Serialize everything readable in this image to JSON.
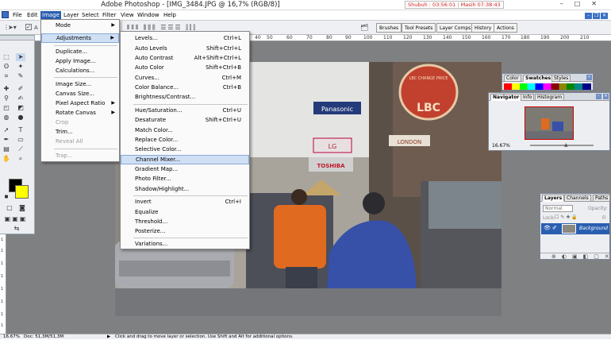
{
  "window": {
    "title": "Adobe Photoshop - [IMG_3484.JPG @ 16,7% (RGB/8)]",
    "status_time": "Shubuh : 03:56:01",
    "status_next": "Masih 07:38:43",
    "controls": [
      "–",
      "□",
      "✕"
    ]
  },
  "menubar": {
    "items": [
      "File",
      "Edit",
      "Image",
      "Layer",
      "Select",
      "Filter",
      "View",
      "Window",
      "Help"
    ],
    "active": "Image",
    "doc_controls": [
      "–",
      "❐",
      "✕"
    ]
  },
  "options_bar": {
    "checkbox_label": "A",
    "size_value": "40",
    "palette_well_tabs": [
      "Brushes",
      "Tool Presets",
      "Layer Comps",
      "History",
      "Actions"
    ]
  },
  "ruler": {
    "h_ticks": [
      "20",
      "30",
      "40",
      "50",
      "60",
      "70",
      "80",
      "90",
      "100",
      "110",
      "120",
      "130",
      "140",
      "150",
      "160",
      "170",
      "180",
      "190",
      "200",
      "210"
    ],
    "v_ticks": [
      "1",
      "1",
      "1",
      "1",
      "1",
      "1",
      "1",
      "1"
    ]
  },
  "image_menu": {
    "items": [
      {
        "label": "Mode",
        "submenu": true
      },
      {
        "label": "Adjustments",
        "submenu": true,
        "highlighted": true
      },
      {
        "sep": true
      },
      {
        "label": "Duplicate..."
      },
      {
        "label": "Apply Image..."
      },
      {
        "label": "Calculations..."
      },
      {
        "sep": true
      },
      {
        "label": "Image Size..."
      },
      {
        "label": "Canvas Size..."
      },
      {
        "label": "Pixel Aspect Ratio",
        "submenu": true
      },
      {
        "label": "Rotate Canvas",
        "submenu": true
      },
      {
        "label": "Crop",
        "disabled": true
      },
      {
        "label": "Trim..."
      },
      {
        "label": "Reveal All",
        "disabled": true
      },
      {
        "sep": true
      },
      {
        "label": "Trap...",
        "disabled": true
      }
    ]
  },
  "adjustments_menu": {
    "items": [
      {
        "label": "Levels...",
        "shortcut": "Ctrl+L"
      },
      {
        "label": "Auto Levels",
        "shortcut": "Shift+Ctrl+L"
      },
      {
        "label": "Auto Contrast",
        "shortcut": "Alt+Shift+Ctrl+L"
      },
      {
        "label": "Auto Color",
        "shortcut": "Shift+Ctrl+B"
      },
      {
        "label": "Curves...",
        "shortcut": "Ctrl+M"
      },
      {
        "label": "Color Balance...",
        "shortcut": "Ctrl+B"
      },
      {
        "label": "Brightness/Contrast..."
      },
      {
        "sep": true
      },
      {
        "label": "Hue/Saturation...",
        "shortcut": "Ctrl+U"
      },
      {
        "label": "Desaturate",
        "shortcut": "Shift+Ctrl+U"
      },
      {
        "label": "Match Color..."
      },
      {
        "label": "Replace Color..."
      },
      {
        "label": "Selective Color..."
      },
      {
        "label": "Channel Mixer...",
        "highlighted": true
      },
      {
        "label": "Gradient Map..."
      },
      {
        "label": "Photo Filter..."
      },
      {
        "label": "Shadow/Highlight..."
      },
      {
        "sep": true
      },
      {
        "label": "Invert",
        "shortcut": "Ctrl+I"
      },
      {
        "label": "Equalize"
      },
      {
        "label": "Threshold..."
      },
      {
        "label": "Posterize..."
      },
      {
        "sep": true
      },
      {
        "label": "Variations..."
      }
    ]
  },
  "photo_signs": {
    "lbc_ring": "LBC CHANGE PRICE",
    "lbc": "LBC",
    "panasonic": "Panasonic",
    "lg": "LG",
    "toshiba": "TOSHIBA",
    "london": "LONDON"
  },
  "color_panel": {
    "tabs": [
      "Color",
      "Swatches",
      "Styles"
    ],
    "active_tab": "Swatches"
  },
  "navigator_panel": {
    "tabs": [
      "Navigator",
      "Info",
      "Histogram"
    ],
    "active_tab": "Navigator",
    "zoom": "16.67%"
  },
  "layers_panel": {
    "tabs": [
      "Layers",
      "Channels",
      "Paths"
    ],
    "active_tab": "Layers",
    "blend_mode": "Normal",
    "opacity_label": "Opacity:",
    "lock_label": "Lock:",
    "fill_label": "Fi",
    "layer_name": "Background"
  },
  "statusbar": {
    "zoom": "16.67%",
    "doc": "Doc: 51,3M/51,3M",
    "hint": "Click and drag to move layer or selection.  Use Shift and Alt for additional options."
  },
  "colors": {
    "accent": "#2a5fb0",
    "workspace": "#7f8082",
    "highlight": "#cfe0f5"
  }
}
